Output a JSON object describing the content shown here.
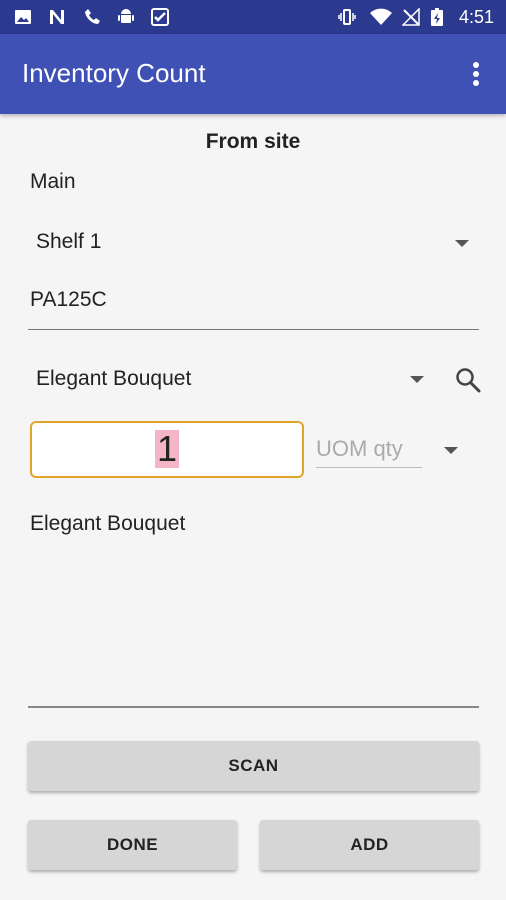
{
  "status_bar": {
    "time": "4:51",
    "icons": [
      "image-icon",
      "n-icon",
      "phone-icon",
      "android-icon",
      "check-icon",
      "vibrate-icon",
      "wifi-icon",
      "no-signal-icon",
      "battery-charging-icon"
    ]
  },
  "app_bar": {
    "title": "Inventory Count",
    "overflow_icon": "more-vert-icon"
  },
  "form": {
    "section_title": "From site",
    "site": "Main",
    "location": "Shelf 1",
    "item_code": "PA125C",
    "item_name": "Elegant Bouquet",
    "quantity": "1",
    "uom_placeholder": "UOM qty",
    "description": "Elegant Bouquet"
  },
  "buttons": {
    "scan": "SCAN",
    "done": "DONE",
    "add": "ADD"
  },
  "colors": {
    "status_bar": "#2b3a8f",
    "app_bar": "#3f51b5",
    "focus_border": "#e0a62a",
    "selection_highlight": "#f4b6c7"
  }
}
